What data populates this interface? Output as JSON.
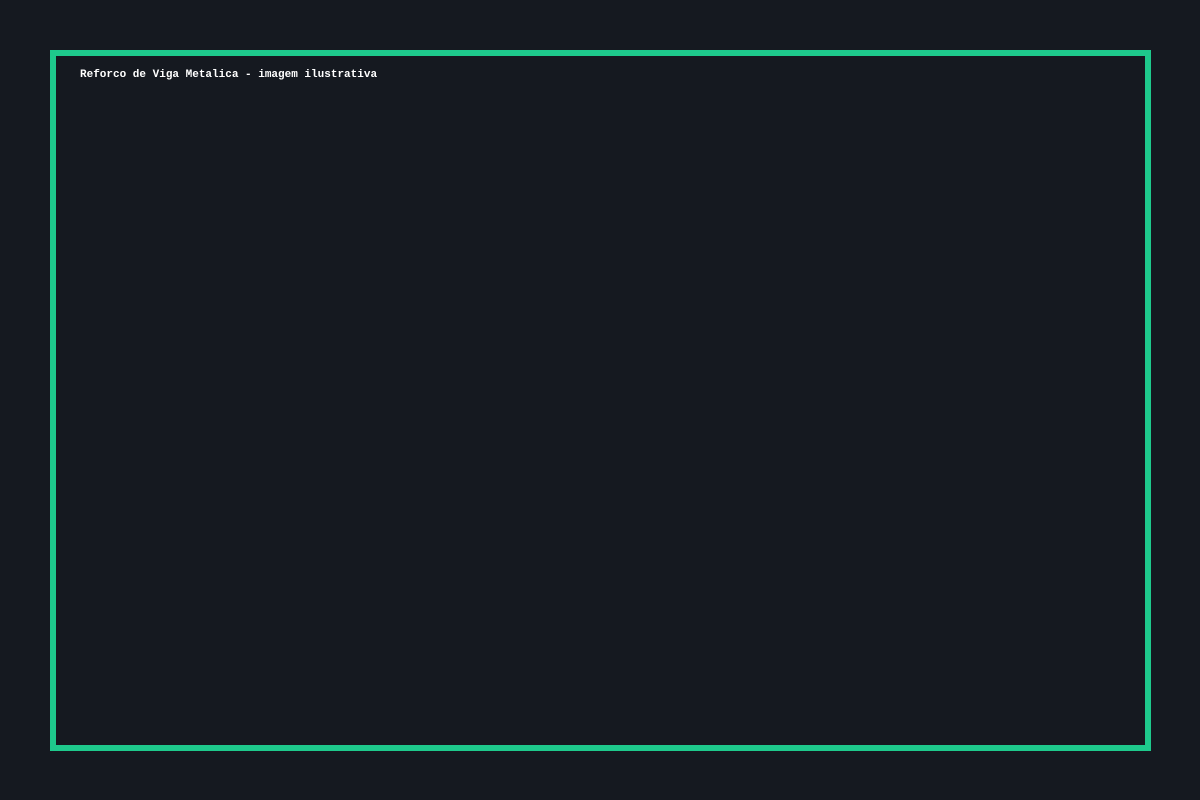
{
  "image": {
    "caption": "Reforco de Viga Metalica - imagem ilustrativa"
  },
  "colors": {
    "background": "#151920",
    "frame_border": "#1ec98c",
    "caption_text": "#ffffff"
  }
}
